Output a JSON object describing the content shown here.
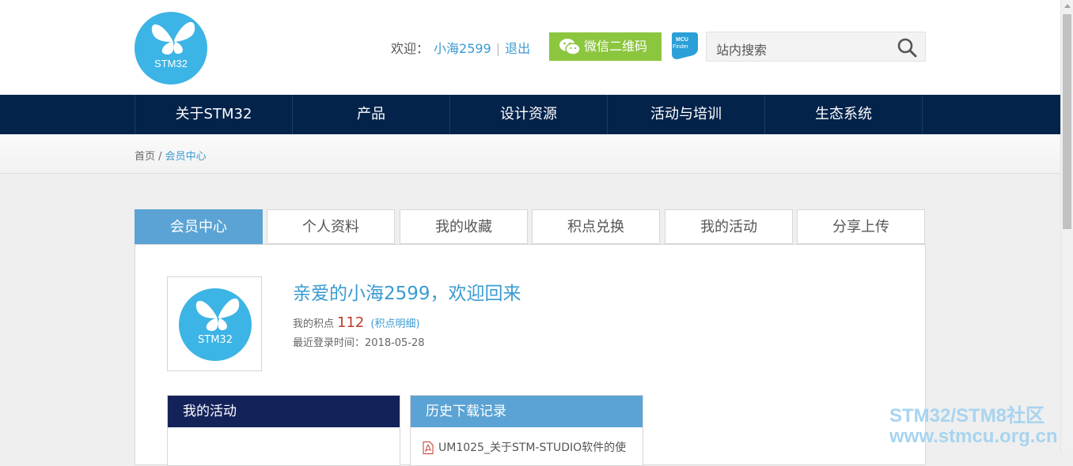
{
  "header": {
    "logo_text": "STM32",
    "welcome_label": "欢迎：",
    "username": "小海2599",
    "divider": "|",
    "logout": "退出",
    "wechat_button": "微信二维码",
    "mcu_finder_icon": "mcu-finder-icon",
    "search_placeholder": "站内搜索"
  },
  "nav": {
    "items": [
      "关于STM32",
      "产品",
      "设计资源",
      "活动与培训",
      "生态系统"
    ]
  },
  "breadcrumb": {
    "home": "首页",
    "separator": " / ",
    "current": "会员中心"
  },
  "tabs": [
    "会员中心",
    "个人资料",
    "我的收藏",
    "积点兑换",
    "我的活动",
    "分享上传"
  ],
  "profile": {
    "avatar_text": "STM32",
    "greeting": "亲爱的小海2599，欢迎回来",
    "points_label": "我的积点",
    "points_value": "112",
    "points_detail": "(积点明细)",
    "last_login_label": "最近登录时间：",
    "last_login_date": "2018-05-28"
  },
  "activity_box": {
    "title": "我的活动",
    "header_color": "#14225a"
  },
  "downloads_box": {
    "title": "历史下载记录",
    "header_color": "#5ba3d4",
    "items": [
      "UM1025_关于STM-STUDIO软件的使"
    ]
  },
  "watermark": {
    "line1": "STM32/STM8社区",
    "line2": "www.stmcu.org.cn"
  },
  "colors": {
    "nav_bg": "#03234b",
    "accent": "#3a9bd1",
    "wechat_green": "#8cc63f",
    "logo_blue": "#3cb4e5"
  }
}
